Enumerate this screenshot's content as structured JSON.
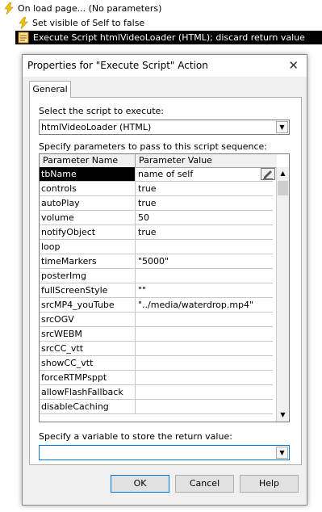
{
  "tree": {
    "rows": [
      {
        "text": "On load page... (No parameters)"
      },
      {
        "text": "Set visible of Self to false"
      },
      {
        "text": "Execute Script htmlVideoLoader (HTML); discard return value"
      }
    ]
  },
  "dialog": {
    "title": "Properties for \"Execute Script\" Action",
    "close_glyph": "✕",
    "tab_label": "General",
    "script_label": "Select the script to execute:",
    "script_value": "htmlVideoLoader (HTML)",
    "params_label": "Specify parameters to pass to this script sequence:",
    "columns": [
      "Parameter Name",
      "Parameter Value"
    ],
    "params": [
      {
        "name": "tbName",
        "value": "name of self"
      },
      {
        "name": "controls",
        "value": "true"
      },
      {
        "name": "autoPlay",
        "value": "true"
      },
      {
        "name": "volume",
        "value": "50"
      },
      {
        "name": "notifyObject",
        "value": "true"
      },
      {
        "name": "loop",
        "value": ""
      },
      {
        "name": "timeMarkers",
        "value": "\"5000\""
      },
      {
        "name": "posterImg",
        "value": ""
      },
      {
        "name": "fullScreenStyle",
        "value": "\"\""
      },
      {
        "name": "srcMP4_youTube",
        "value": "\"../media/waterdrop.mp4\""
      },
      {
        "name": "srcOGV",
        "value": ""
      },
      {
        "name": "srcWEBM",
        "value": ""
      },
      {
        "name": "srcCC_vtt",
        "value": ""
      },
      {
        "name": "showCC_vtt",
        "value": ""
      },
      {
        "name": "forceRTMPsppt",
        "value": ""
      },
      {
        "name": "allowFlashFallback",
        "value": ""
      },
      {
        "name": "disableCaching",
        "value": ""
      }
    ],
    "return_label": "Specify a variable to store the return value:",
    "return_value": "",
    "buttons": {
      "ok": "OK",
      "cancel": "Cancel",
      "help": "Help"
    }
  },
  "colors": {
    "selection": "#000000",
    "accent": "#0078d7",
    "dialog_bg": "#f0f0f0"
  }
}
